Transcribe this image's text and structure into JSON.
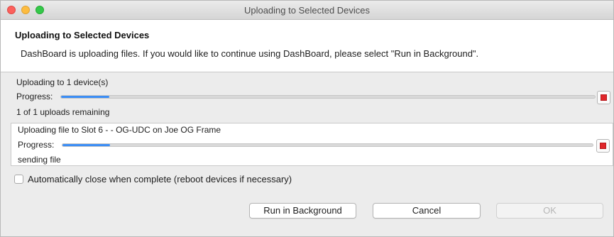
{
  "window": {
    "title": "Uploading to Selected Devices"
  },
  "header": {
    "title": "Uploading to Selected Devices",
    "message": "DashBoard is uploading files.  If you would like to continue using DashBoard, please select \"Run in Background\"."
  },
  "overall": {
    "label": "Uploading to 1 device(s)",
    "progress_label": "Progress:",
    "progress_fraction": 0.09,
    "remaining": "1 of 1 uploads remaining"
  },
  "file": {
    "label": "Uploading file to Slot 6 -  - OG-UDC on Joe OG Frame",
    "progress_label": "Progress:",
    "progress_fraction": 0.09,
    "status": "sending file"
  },
  "auto_close": {
    "label": "Automatically close when complete (reboot devices if necessary)",
    "checked": false
  },
  "buttons": {
    "run_in_background": "Run in Background",
    "cancel": "Cancel",
    "ok": "OK"
  },
  "icons": {
    "stop": "stop-icon"
  },
  "colors": {
    "progress_fill": "#3c8ef5",
    "stop_red": "#e0262a"
  }
}
